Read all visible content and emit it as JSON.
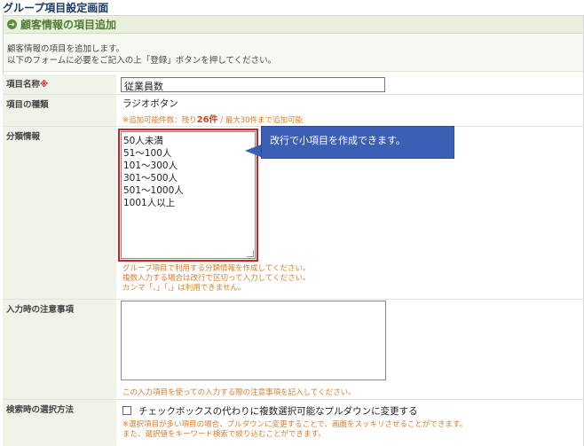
{
  "page_title": "グループ項目設定画面",
  "section": {
    "title": "顧客情報の項目追加",
    "icon": "arrow-right-circle-icon"
  },
  "intro": {
    "line1": "顧客情報の項目を追加します。",
    "line2": "以下のフォームに必要をご記入の上「登録」ボタンを押してください。"
  },
  "fields": {
    "name": {
      "label": "項目名称",
      "required_mark": "※",
      "value": "従業員数"
    },
    "type": {
      "label": "項目の種類",
      "value": "ラジオボタン",
      "note_prefix": "※追加可能件数：残り",
      "note_count": "26件",
      "note_suffix": " / 最大30件まで追加可能"
    },
    "category": {
      "label": "分類情報",
      "values": [
        "50人未満",
        "51～100人",
        "101～300人",
        "301～500人",
        "501～1000人",
        "1001人以上"
      ],
      "callout": "改行で小項目を作成できます。",
      "notes": [
        "グループ項目で利用する分類情報を作成してください。",
        "複数入力する場合は改行で区切って入力してください。",
        "カンマ「、」「,」は利用できません。"
      ]
    },
    "attention": {
      "label": "入力時の注意事項",
      "value": "",
      "note": "この入力項目を使っての入力する際の注意事項を記入してください。"
    },
    "search": {
      "label": "検索時の選択方法",
      "checkbox_label": "チェックボックスの代わりに複数選択可能なプルダウンに変更する",
      "checked": false,
      "notes": [
        "※選択項目が多い項目の場合、プルダウンに変更することで、画面をスッキリさせることができます。",
        "また、選択値をキーワード検索で絞り込むことができます。"
      ]
    }
  },
  "colors": {
    "accent_green": "#4f7b32",
    "label_bg": "#eef3e8",
    "note_orange": "#e07b28",
    "highlight_red": "#d31e1e",
    "callout_blue": "#3b5fb5"
  }
}
